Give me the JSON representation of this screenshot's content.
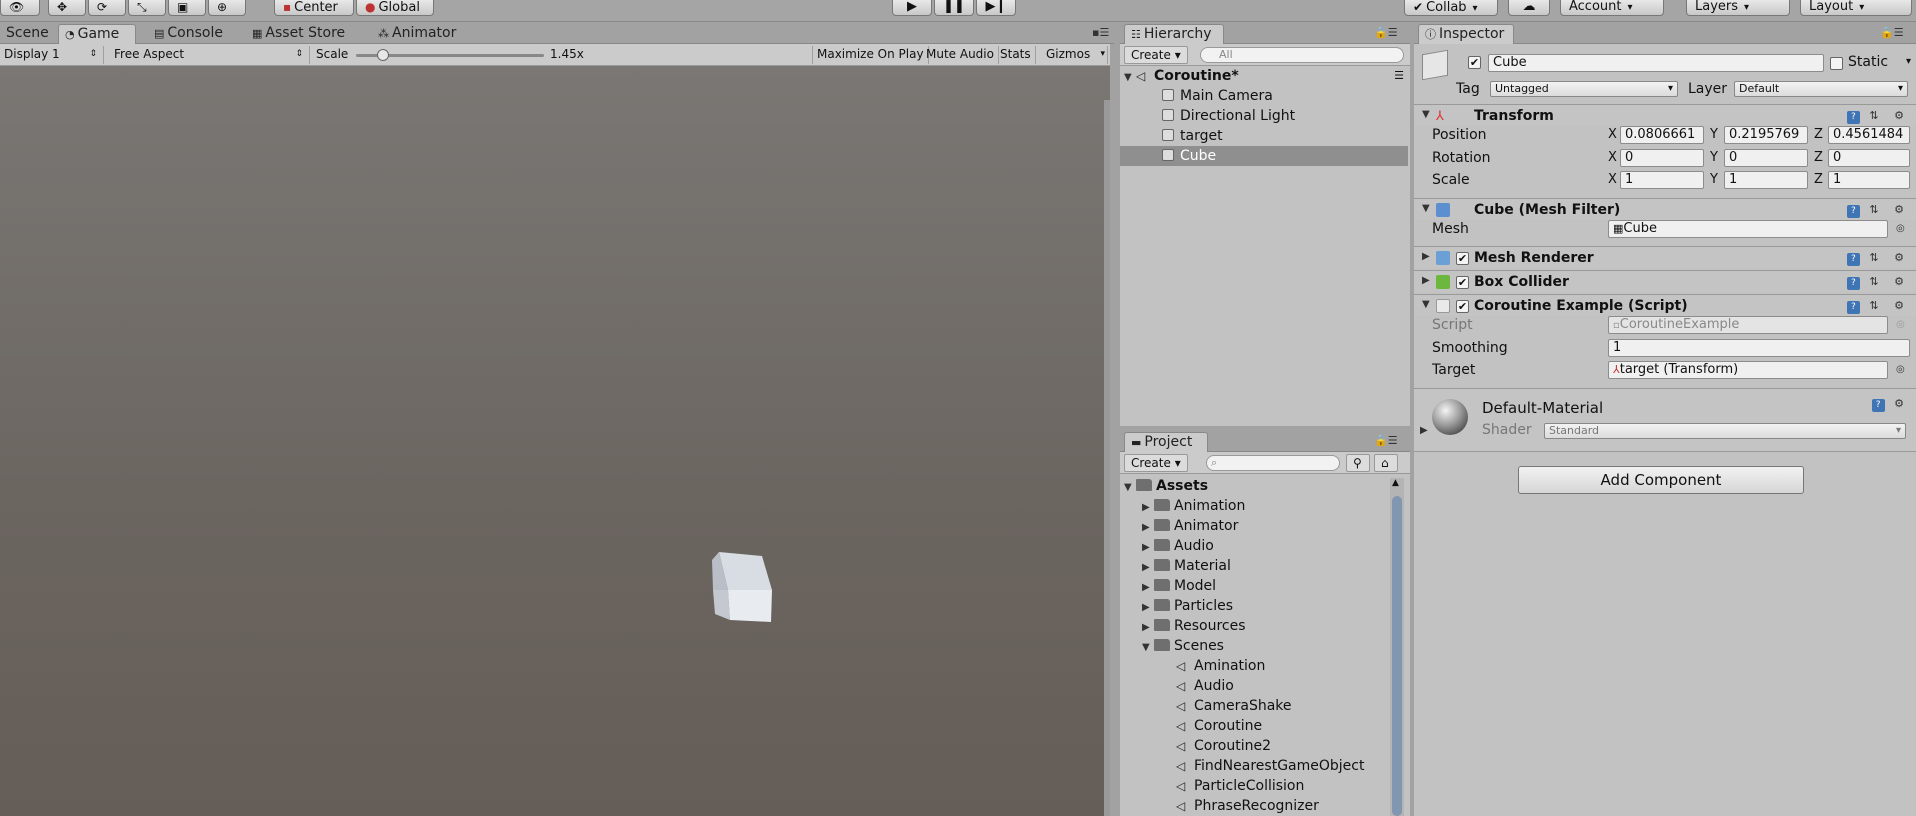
{
  "toolbar": {
    "pivot": "Center",
    "space": "Global",
    "collab": "Collab",
    "account": "Account",
    "layers": "Layers",
    "layout": "Layout"
  },
  "tabs": {
    "scene": "Scene",
    "game": "Game",
    "console": "Console",
    "asset_store": "Asset Store",
    "animator": "Animator",
    "hierarchy": "Hierarchy",
    "project": "Project",
    "inspector": "Inspector"
  },
  "gamebar": {
    "display": "Display 1",
    "aspect": "Free Aspect",
    "scale_label": "Scale",
    "scale_value": "1.45x",
    "scale_fraction": 0.12,
    "maximize": "Maximize On Play",
    "mute": "Mute Audio",
    "stats": "Stats",
    "gizmos": "Gizmos"
  },
  "hierarchy": {
    "create": "Create",
    "search_placeholder": "All",
    "scene": "Coroutine*",
    "items": [
      "Main Camera",
      "Directional Light",
      "target",
      "Cube"
    ],
    "selected": "Cube"
  },
  "project": {
    "create": "Create",
    "root": "Assets",
    "folders": [
      "Animation",
      "Animator",
      "Audio",
      "Material",
      "Model",
      "Particles",
      "Resources",
      "Scenes"
    ],
    "scenes": [
      "Amination",
      "Audio",
      "CameraShake",
      "Coroutine",
      "Coroutine2",
      "FindNearestGameObject",
      "ParticleCollision",
      "PhraseRecognizer"
    ]
  },
  "inspector": {
    "object_name": "Cube",
    "static_label": "Static",
    "tag_label": "Tag",
    "tag_value": "Untagged",
    "layer_label": "Layer",
    "layer_value": "Default",
    "transform": {
      "title": "Transform",
      "position_label": "Position",
      "rotation_label": "Rotation",
      "scale_label": "Scale",
      "axis_x": "X",
      "axis_y": "Y",
      "axis_z": "Z",
      "position": [
        "0.0806661",
        "0.2195769",
        "0.4561484"
      ],
      "rotation": [
        "0",
        "0",
        "0"
      ],
      "scale": [
        "1",
        "1",
        "1"
      ]
    },
    "mesh_filter": {
      "title": "Cube (Mesh Filter)",
      "mesh_label": "Mesh",
      "mesh_value": "Cube"
    },
    "mesh_renderer": {
      "title": "Mesh Renderer"
    },
    "box_collider": {
      "title": "Box Collider"
    },
    "script_comp": {
      "title": "Coroutine Example (Script)",
      "script_label": "Script",
      "script_value": "CoroutineExample",
      "smoothing_label": "Smoothing",
      "smoothing_value": "1",
      "target_label": "Target",
      "target_value": "target (Transform)"
    },
    "material": {
      "name": "Default-Material",
      "shader_label": "Shader",
      "shader_value": "Standard"
    },
    "add_component": "Add Component"
  }
}
